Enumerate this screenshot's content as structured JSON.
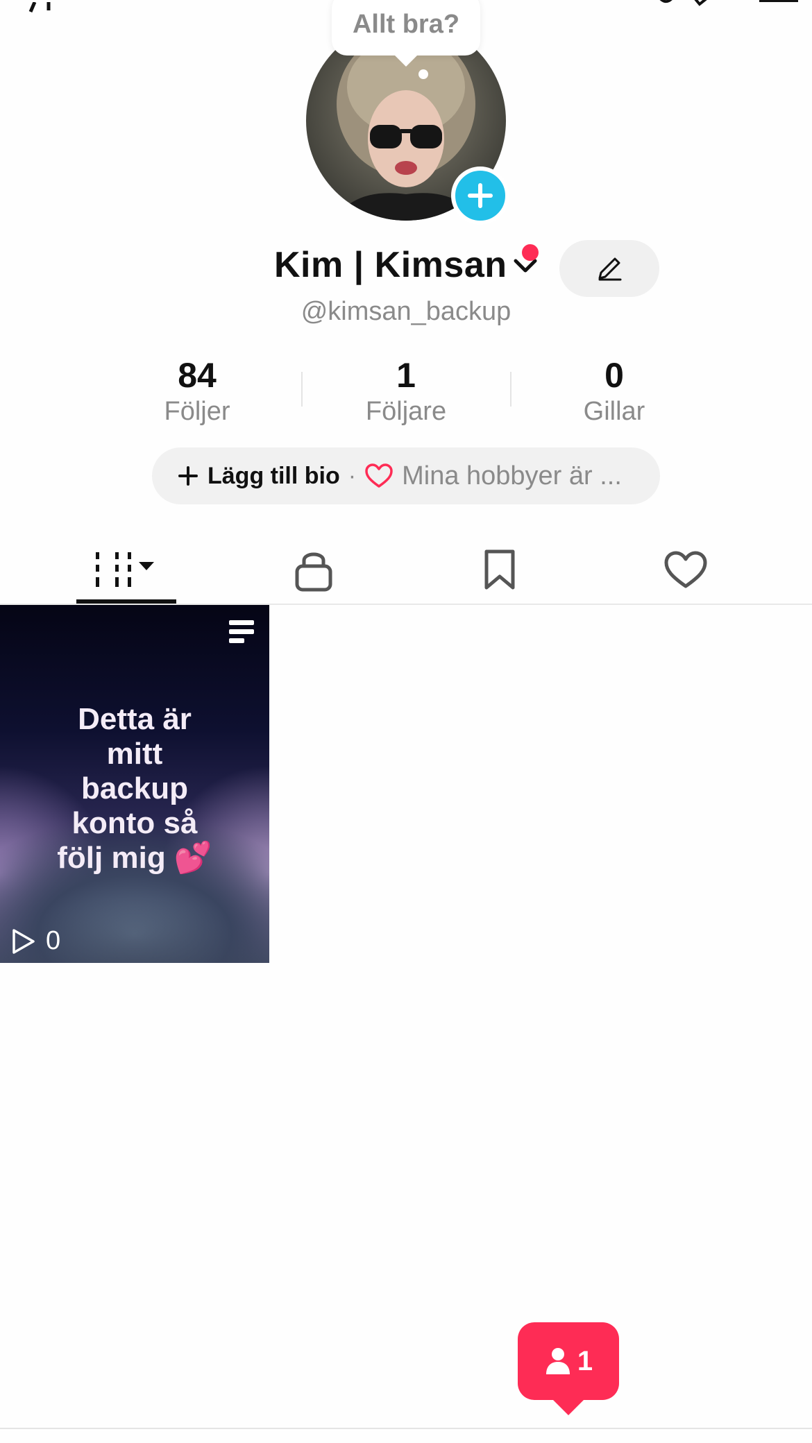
{
  "tooltip": {
    "text": "Allt bra?"
  },
  "profile": {
    "display_name": "Kim | Kimsan",
    "username": "@kimsan_backup"
  },
  "stats": [
    {
      "value": "84",
      "label": "Följer"
    },
    {
      "value": "1",
      "label": "Följare"
    },
    {
      "value": "0",
      "label": "Gillar"
    }
  ],
  "bio": {
    "add_label": "Lägg till bio",
    "separator": "·",
    "text": "Mina hobbyer är ..."
  },
  "tabs": [
    {
      "icon": "videos-grid-icon"
    },
    {
      "icon": "lock-icon"
    },
    {
      "icon": "bookmark-icon"
    },
    {
      "icon": "heart-icon"
    }
  ],
  "videos": [
    {
      "caption": "Detta är\nmitt\nbackup\nkonto så\nfölj mig 💕",
      "views": "0"
    }
  ],
  "notification": {
    "count": "1"
  },
  "colors": {
    "accent": "#fe2c55",
    "add_button": "#22bfe8",
    "muted_text": "#8a8a8a"
  }
}
